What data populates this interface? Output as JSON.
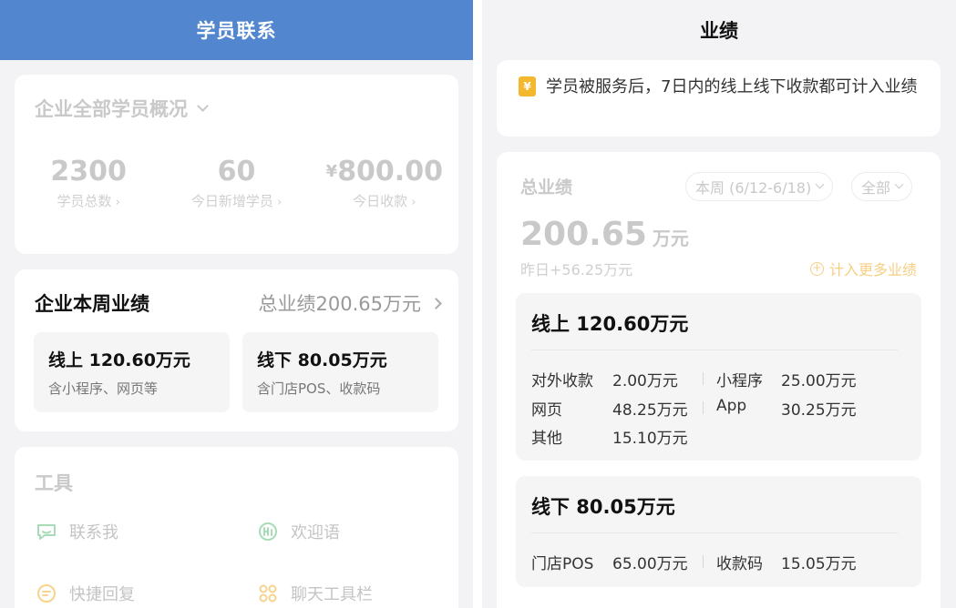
{
  "left": {
    "header_title": "学员联系",
    "overview": {
      "title": "企业全部学员概况",
      "stats": [
        {
          "value": "2300",
          "label": "学员总数"
        },
        {
          "value": "60",
          "label": "今日新增学员"
        },
        {
          "currency": "¥",
          "value": "800.00",
          "label": "今日收款"
        }
      ]
    },
    "weekly": {
      "title": "企业本周业绩",
      "total_label": "总业绩200.65万元",
      "online": {
        "title": "线上 120.60万元",
        "desc": "含小程序、网页等"
      },
      "offline": {
        "title": "线下 80.05万元",
        "desc": "含门店POS、收款码"
      }
    },
    "tools": {
      "title": "工具",
      "items": [
        "联系我",
        "欢迎语",
        "快捷回复",
        "聊天工具栏"
      ]
    }
  },
  "right": {
    "header_title": "业绩",
    "notice": "学员被服务后，7日内的线上线下收款都可计入业绩",
    "perf": {
      "title": "总业绩",
      "period": "本周 (6/12-6/18)",
      "filter": "全部",
      "total_value": "200.65",
      "total_unit": "万元",
      "yesterday": "昨日+56.25万元",
      "more_link": "计入更多业绩"
    },
    "online": {
      "title": "线上  120.60万元",
      "rows": [
        {
          "k": "对外收款",
          "v": "2.00万元",
          "k2": "小程序",
          "v2": "25.00万元"
        },
        {
          "k": "网页",
          "v": "48.25万元",
          "k2": "App",
          "v2": "30.25万元"
        },
        {
          "k": "其他",
          "v": "15.10万元"
        }
      ]
    },
    "offline": {
      "title": "线下  80.05万元",
      "rows": [
        {
          "k": "门店POS",
          "v": "65.00万元",
          "k2": "收款码",
          "v2": "15.05万元"
        }
      ]
    }
  },
  "colors": {
    "header_blue": "#5286cf",
    "notice_icon": "#f4b82f",
    "link_orange": "#f6cf83",
    "tool_icon_green": "#a8dcb8",
    "tool_icon_yellow": "#f6d48c"
  }
}
